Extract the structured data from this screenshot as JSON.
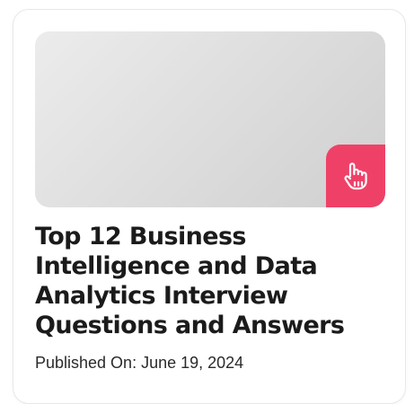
{
  "article": {
    "title": "Top 12 Business Intelligence and Data Analytics Interview Questions and Answers",
    "published_label": "Published On:",
    "published_date": "June 19, 2024"
  },
  "badge": {
    "icon": "tap-hand-icon",
    "color": "#ef4168"
  }
}
